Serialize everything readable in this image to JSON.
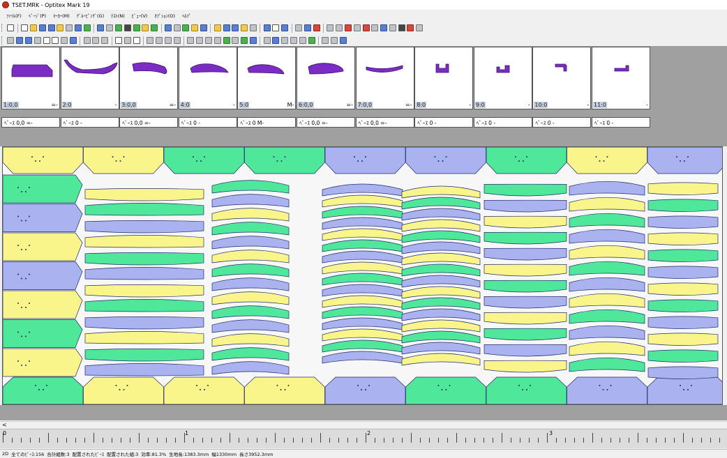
{
  "window": {
    "title": "TSET.MRK - Optitex Mark 19"
  },
  "menu": [
    "ﾌｧｲﾙ(F)",
    "ﾍﾟｰｼﾞ(P)",
    "ﾏｰｶｰ(M)",
    "ｸﾞﾙｰﾋﾟﾝｸﾞ(G)",
    "ﾃｽﾄ(N)",
    "ﾋﾞｭｰ(V)",
    "ｵﾌﾟｼｮﾝ(O)",
    "ﾍﾙﾌﾟ"
  ],
  "pieces": [
    {
      "label": "1:0,0",
      "suffix": "=-",
      "info": "ﾍﾞｰｽ 0,0 =-"
    },
    {
      "label": "2:0",
      "suffix": "-",
      "info": "ﾍﾞｰｽ 0 -"
    },
    {
      "label": "3:0,0",
      "suffix": "=-",
      "info": "ﾍﾞｰｽ 0,0 =-"
    },
    {
      "label": "4:0",
      "suffix": "-",
      "info": "ﾍﾞｰｽ 0 -"
    },
    {
      "label": "5:0",
      "suffix": "M-",
      "info": "ﾍﾞｰｽ 0 M-"
    },
    {
      "label": "6:0,0",
      "suffix": "=-",
      "info": "ﾍﾞｰｽ 0,0 =-"
    },
    {
      "label": "7:0,0",
      "suffix": "=-",
      "info": "ﾍﾞｰｽ 0,0 =-"
    },
    {
      "label": "8:0",
      "suffix": "-",
      "info": "ﾍﾞｰｽ 0 -"
    },
    {
      "label": "9:0",
      "suffix": "-",
      "info": "ﾍﾞｰｽ 0 -"
    },
    {
      "label": "10:0",
      "suffix": "-",
      "info": "ﾍﾞｰｽ 0 -"
    },
    {
      "label": "11:0",
      "suffix": "-",
      "info": "ﾍﾞｰｽ 0 -"
    }
  ],
  "ruler": {
    "labels": [
      "0",
      "1",
      "2",
      "3"
    ]
  },
  "status": [
    "2D",
    "全てのﾋﾟｰｽ:156",
    "合計組数:3",
    "配置されたﾋﾟｰｽ",
    "配置された組:3",
    "効率:81.3%",
    "生地長:1383.3mm",
    "幅1330mm",
    "長さ3952.3mm"
  ],
  "colors": {
    "piece_purple": "#7b2cc4",
    "green": "#4fe89a",
    "yellow": "#f9f58a",
    "blue": "#aab2f0",
    "outline": "#1f2b6b",
    "panel_gray": "#a0a0a0"
  }
}
